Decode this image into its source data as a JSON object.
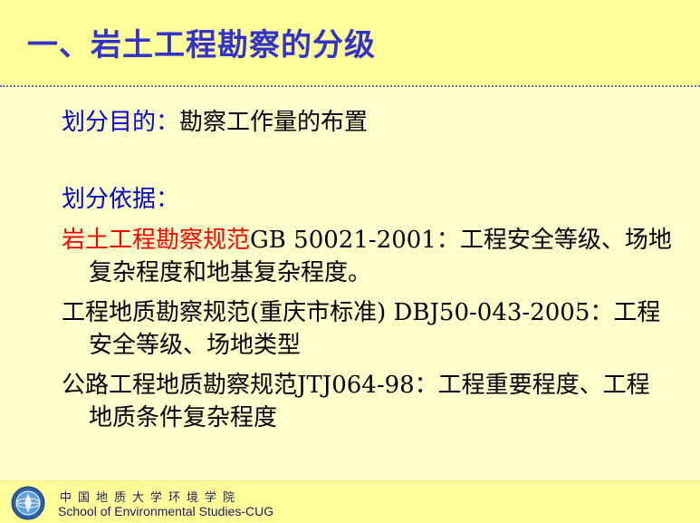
{
  "title": "一、岩土工程勘察的分级",
  "purpose": {
    "label": "划分目的：",
    "text": "勘察工作量的布置"
  },
  "basis": {
    "label": "划分依据："
  },
  "items": [
    {
      "highlight": "岩土工程勘察规范",
      "line1": "GB 50021-2001：工程安全等级、场地",
      "line2": "复杂程度和地基复杂程度。"
    },
    {
      "line1": "工程地质勘察规范(重庆市标准) DBJ50-043-2005：工程",
      "line2": "安全等级、场地类型"
    },
    {
      "line1": "公路工程地质勘察规范JTJ064-98：工程重要程度、工程",
      "line2": "地质条件复杂程度"
    }
  ],
  "footer": {
    "cn": "中国地质大学环境学院",
    "en": "School of Environmental Studies-CUG"
  },
  "colors": {
    "title": "#3333cc",
    "label": "#0000cc",
    "highlight": "#ff0000",
    "background": "#ffffcc",
    "band": "#ffff99"
  }
}
